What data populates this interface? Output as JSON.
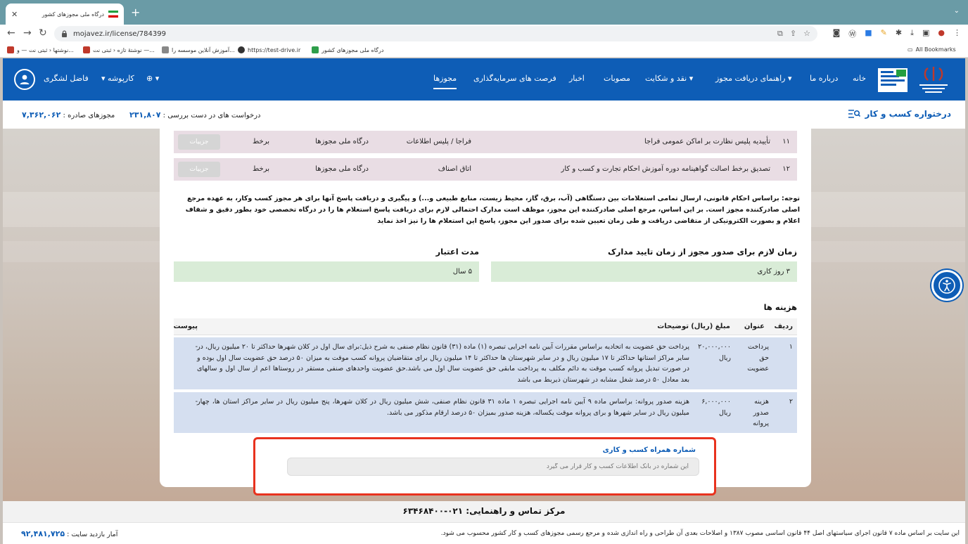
{
  "browser": {
    "tab_title": "درگاه ملی مجوزهای کشور",
    "url": "mojavez.ir/license/784399",
    "all_bookmarks": "All Bookmarks",
    "bookmarks": [
      "نوشتها ‹ ثبتی نت — و...",
      "نوشتهٔ تازه ‹ ثبتی نت —...",
      "آموزش آنلاین موسسه را...",
      "https://test-drive.ir",
      "درگاه ملی مجوزهای کشور"
    ]
  },
  "header": {
    "nav": [
      "خانه",
      "درباره ما",
      "راهنمای دریافت مجوز",
      "نقد و شکایت",
      "مصوبات",
      "اخبار",
      "فرصت های سرمایه‌گذاری",
      "مجوزها"
    ],
    "user_menu": "کارپوشه",
    "user_name": "فاضل لشگری"
  },
  "subheader": {
    "issued_label": "مجوزهای صادره :",
    "issued_value": "۷,۳۶۲,۰۶۲",
    "pending_label": "درخواست های در دست بررسی :",
    "pending_value": "۲۳۱,۸۰۷",
    "business_link": "درختواره کسب و کار"
  },
  "requirements": [
    {
      "num": "۱۱",
      "title": "تأییدیه پلیس نظارت بر اماکن عمومی فراجا",
      "authority": "فراجا / پلیس اطلاعات",
      "channel": "درگاه ملی مجوزها",
      "mode": "برخط",
      "button": "جزییات"
    },
    {
      "num": "۱۲",
      "title": "تصدیق برخط اصالت گواهینامه دوره آموزش احکام تجارت و کسب و کار",
      "authority": "اتاق اصناف",
      "channel": "درگاه ملی مجوزها",
      "mode": "برخط",
      "button": "جزییات"
    }
  ],
  "note": "توجه: براساس احکام قانونی، ارسال تمامی استعلامات بین دستگاهی (آب، برق، گاز، محیط زیست، منابع طبیعی و...) و پیگیری و دریافت پاسخ آنها برای هر مجوز کسب وکار، به عهده مرجع اصلی صادرکننده مجوز است. بر این اساس، مرجع اصلی صادرکننده این مجوز، موظف است مدارک احتمالی لازم برای دریافت پاسخ استعلام ها را در درگاه تخصصی خود بطور دقیق و شفاف اعلام و بصورت الکترونیکی از متقاضی دریافت و طی زمان تعیین شده برای صدور این مجوز، پاسخ این استعلام ها را نیز اخذ نماید",
  "timing": {
    "issue_label": "زمان لازم برای صدور مجوز از زمان تایید مدارک",
    "issue_value": "۳ روز کاری",
    "validity_label": "مدت اعتبار",
    "validity_value": "۵ سال"
  },
  "fees": {
    "title": "هزینه ها",
    "columns": {
      "row": "ردیف",
      "name": "عنوان",
      "amount": "مبلغ (ریال)",
      "desc": "توضیحات",
      "attach": "پیوست"
    },
    "rows": [
      {
        "num": "۱",
        "name": "پرداخت حق عضویت",
        "amount": "۲۰,۰۰۰,۰۰۰ ریال",
        "desc": "پرداخت حق عضویت به اتحادیه براساس مقررات آیین نامه اجرایی تبصره (۱) ماده (۳۱) قانون نظام صنفی به شرح ذیل:برای سال اول در کلان شهرها حداکثر تا ۲۰ میلیون ریال، در سایر مراکز استانها حداکثر تا ۱۷ میلیون ریال و در سایر شهرستان ها حداکثر تا ۱۴ میلیون ریال برای متقاضیان پروانه کسب موقت به میزان ۵۰ درصد حق عضویت سال اول بوده و در صورت تبدیل پروانه کسب موقت به دائم مکلف به پرداخت مابقی حق عضویت سال اول می باشد.حق عضویت واحدهای صنفی مستقر در روستاها اعم از سال اول و سالهای بعد معادل ۵۰ درصد شغل مشابه در شهرستان ذیربط می باشد",
        "attach": "-"
      },
      {
        "num": "۲",
        "name": "هزینه صدور پروانه",
        "amount": "۶,۰۰۰,۰۰۰ ریال",
        "desc": "هزینه صدور پروانه: براساس ماده ۹ آیین نامه اجرایی تبصره ۱ ماده ۳۱ قانون نظام صنفی، شش میلیون ریال در کلان شهرها، پنج میلیون ریال در سایر مراکز استان ها، چهار میلیون ریال در سایر شهرها و برای پروانه موقت یکساله، هزینه صدور بمیزان ۵۰ درصد ارقام مذکور می باشد.",
        "attach": "-"
      }
    ]
  },
  "mobile": {
    "label": "شماره همراه کسب و کاری",
    "placeholder": "این شماره در بانک اطلاعات کسب و کار قرار می گیرد"
  },
  "contact": "مرکز تماس و راهنمایی: ۰۲۱-۶۳۴۶۸۴۰۰",
  "footer": {
    "text": "این سایت بر اساس ماده ۷ قانون اجرای سیاستهای اصل ۴۴ قانون اساسی مصوب ۱۳۸۷ و اصلاحات بعدی آن طراحی و راه اندازی شده و مرجع رسمی مجوزهای کسب و کار کشور محسوب می شود.",
    "visits_label": "آمار بازدید سایت :",
    "visits_value": "۹۲,۴۸۱,۷۲۵"
  }
}
